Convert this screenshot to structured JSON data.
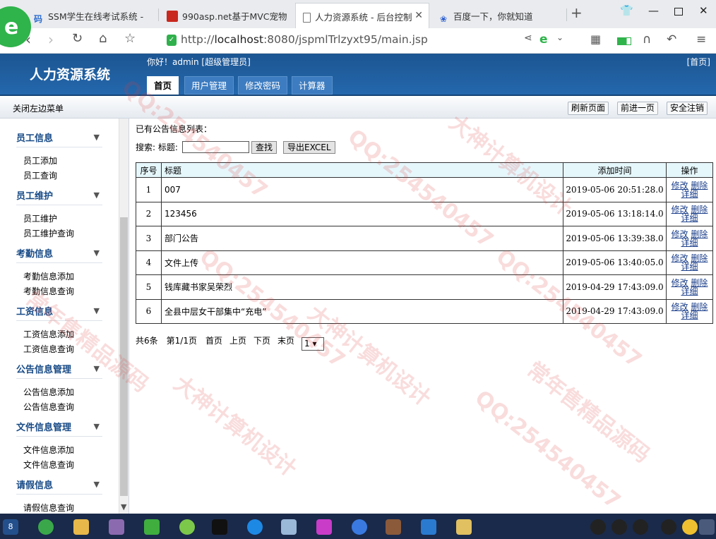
{
  "browser": {
    "tabs": [
      {
        "icon": "码",
        "title": "SSM学生在线考试系统 -"
      },
      {
        "icon": "",
        "title": "990asp.net基于MVC宠物"
      },
      {
        "icon": "",
        "title": "人力资源系统 - 后台控制"
      },
      {
        "icon": "",
        "title": "百度一下，你就知道"
      }
    ],
    "new_tab": "+",
    "url_prefix": "http://",
    "url_host": "localhost",
    "url_rest": ":8080/jspmlTrlzyxt95/main.jsp",
    "logo": "e"
  },
  "header": {
    "title": "人力资源系统",
    "welcome": "你好！admin [超级管理员]",
    "home": "[首页]",
    "tabs": [
      "首页",
      "用户管理",
      "修改密码",
      "计算器"
    ]
  },
  "toolbar": {
    "close_menu": "关闭左边菜单",
    "refresh": "刷新页面",
    "forward": "前进一页",
    "logout": "安全注销"
  },
  "sidebar": {
    "groups": [
      {
        "title": "员工信息",
        "items": [
          "员工添加",
          "员工查询"
        ]
      },
      {
        "title": "员工维护",
        "items": [
          "员工维护",
          "员工维护查询"
        ]
      },
      {
        "title": "考勤信息",
        "items": [
          "考勤信息添加",
          "考勤信息查询"
        ]
      },
      {
        "title": "工资信息",
        "items": [
          "工资信息添加",
          "工资信息查询"
        ]
      },
      {
        "title": "公告信息管理",
        "items": [
          "公告信息添加",
          "公告信息查询"
        ]
      },
      {
        "title": "文件信息管理",
        "items": [
          "文件信息添加",
          "文件信息查询"
        ]
      },
      {
        "title": "请假信息",
        "items": [
          "请假信息查询"
        ]
      }
    ]
  },
  "main": {
    "list_label": "已有公告信息列表：",
    "search_label": "搜索: 标题:",
    "search_value": "",
    "find_button": "查找",
    "export_button": "导出EXCEL",
    "columns": [
      "序号",
      "标题",
      "添加时间",
      "操作"
    ],
    "rows": [
      {
        "no": "1",
        "title": "007",
        "time": "2019-05-06 20:51:28.0"
      },
      {
        "no": "2",
        "title": "123456",
        "time": "2019-05-06 13:18:14.0"
      },
      {
        "no": "3",
        "title": "部门公告",
        "time": "2019-05-06 13:39:38.0"
      },
      {
        "no": "4",
        "title": "文件上传",
        "time": "2019-05-06 13:40:05.0"
      },
      {
        "no": "5",
        "title": "钱库藏书家吴荣烈",
        "time": "2019-04-29 17:43:09.0"
      },
      {
        "no": "6",
        "title": "全县中层女干部集中“充电”",
        "time": "2019-04-29 17:43:09.0"
      }
    ],
    "ops": {
      "edit": "修改",
      "delete": "删除",
      "detail": "详细"
    },
    "pager": {
      "total": "共6条",
      "page": "第1/1页",
      "first": "首页",
      "prev": "上页",
      "next": "下页",
      "last": "末页",
      "selected": "1 ▾"
    }
  },
  "watermarks": [
    "QQ:254540457",
    "大神计算机设计",
    "常年售精品源码"
  ]
}
